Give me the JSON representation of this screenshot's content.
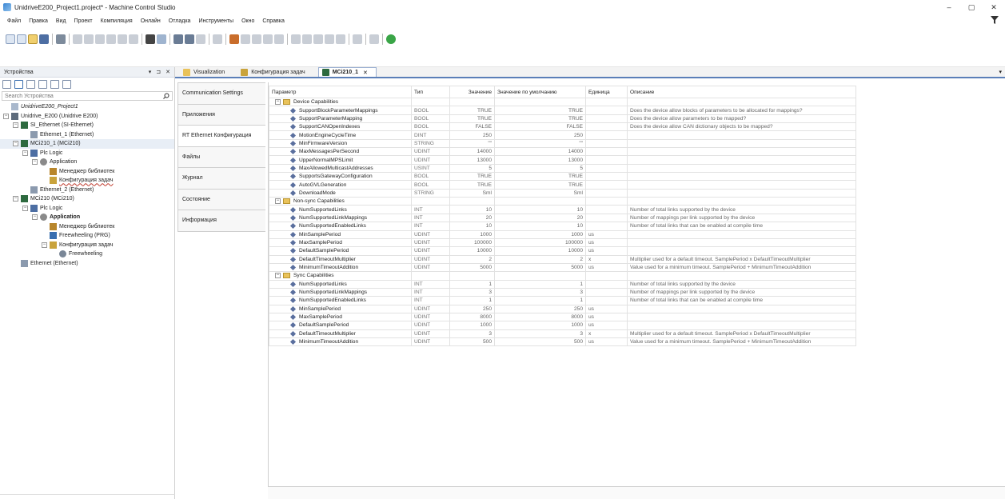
{
  "window": {
    "title": "UnidriveE200_Project1.project* - Machine Control Studio",
    "buttons": [
      "–",
      "▢",
      "✕"
    ]
  },
  "menu": [
    "Файл",
    "Правка",
    "Вид",
    "Проект",
    "Компиляция",
    "Онлайн",
    "Отладка",
    "Инструменты",
    "Окно",
    "Справка"
  ],
  "devices_pane": {
    "title": "Устройства",
    "controls": [
      "▾",
      "⊐",
      "✕"
    ],
    "search_placeholder": "Search Устройства",
    "tree": [
      {
        "label": "UnidriveE200_Project1",
        "level": 0,
        "exp": "",
        "icon": "project",
        "style": "italic"
      },
      {
        "label": "Unidrive_E200 (Unidrive E200)",
        "level": 0,
        "exp": "−",
        "icon": "drive",
        "style": ""
      },
      {
        "label": "SI_Ethernet (SI-Ethernet)",
        "level": 1,
        "exp": "−",
        "icon": "module",
        "style": ""
      },
      {
        "label": "Ethernet_1 (Ethernet)",
        "level": 2,
        "exp": "",
        "icon": "eth",
        "style": ""
      },
      {
        "label": "MCi210_1 (MCi210)",
        "level": 1,
        "exp": "−",
        "icon": "module",
        "style": "",
        "selected": true
      },
      {
        "label": "Plc Logic",
        "level": 2,
        "exp": "−",
        "icon": "plc",
        "style": ""
      },
      {
        "label": "Application",
        "level": 3,
        "exp": "−",
        "icon": "app",
        "style": ""
      },
      {
        "label": "Менеджер библиотек",
        "level": 4,
        "exp": "",
        "icon": "lib",
        "style": ""
      },
      {
        "label": "Конфигурация задач",
        "level": 4,
        "exp": "",
        "icon": "task",
        "style": "underline"
      },
      {
        "label": "Ethernet_2 (Ethernet)",
        "level": 2,
        "exp": "",
        "icon": "eth",
        "style": ""
      },
      {
        "label": "MCi210 (MCi210)",
        "level": 1,
        "exp": "−",
        "icon": "module",
        "style": ""
      },
      {
        "label": "Plc Logic",
        "level": 2,
        "exp": "−",
        "icon": "plc",
        "style": ""
      },
      {
        "label": "Application",
        "level": 3,
        "exp": "−",
        "icon": "app",
        "style": "bold"
      },
      {
        "label": "Менеджер библиотек",
        "level": 4,
        "exp": "",
        "icon": "lib",
        "style": ""
      },
      {
        "label": "Freewheeling (PRG)",
        "level": 4,
        "exp": "",
        "icon": "prg",
        "style": ""
      },
      {
        "label": "Конфигурация задач",
        "level": 4,
        "exp": "−",
        "icon": "task",
        "style": ""
      },
      {
        "label": "Freewheeling",
        "level": 5,
        "exp": "",
        "icon": "gear",
        "style": ""
      },
      {
        "label": "Ethernet (Ethernet)",
        "level": 1,
        "exp": "",
        "icon": "eth",
        "style": ""
      }
    ]
  },
  "editor_tabs": [
    {
      "label": "Visualization",
      "icon": "visu",
      "active": false
    },
    {
      "label": "Конфигурация задач",
      "icon": "task",
      "active": false
    },
    {
      "label": "MCi210_1",
      "icon": "module",
      "active": true,
      "close": "✕"
    }
  ],
  "side_tabs": [
    "Communication Settings",
    "Приложения",
    "RT Ethernet Конфигурация",
    "Файлы",
    "Журнал",
    "Состояние",
    "Информация"
  ],
  "side_tab_active": 2,
  "grid": {
    "headers": [
      "Параметр",
      "Тип",
      "Значение",
      "Значение по умолчанию",
      "Единица",
      "Описание"
    ],
    "groups": [
      {
        "name": "Device Capabilities",
        "rows": [
          {
            "name": "SupportBlockParameterMappings",
            "type": "BOOL",
            "value": "TRUE",
            "default": "TRUE",
            "unit": "",
            "desc": "Does the device allow blocks of parameters to be allocated for mappings?"
          },
          {
            "name": "SupportParameterMapping",
            "type": "BOOL",
            "value": "TRUE",
            "default": "TRUE",
            "unit": "",
            "desc": "Does the device allow parameters to be mapped?"
          },
          {
            "name": "SupportCANOpenIndexes",
            "type": "BOOL",
            "value": "FALSE",
            "default": "FALSE",
            "unit": "",
            "desc": "Does the device allow CAN dictionary objects to be mapped?"
          },
          {
            "name": "MotionEngineCycleTime",
            "type": "DINT",
            "value": "250",
            "default": "250",
            "unit": "",
            "desc": ""
          },
          {
            "name": "MinFirmwareVersion",
            "type": "STRING",
            "value": "\"\"",
            "default": "\"\"",
            "unit": "",
            "desc": ""
          },
          {
            "name": "MaxMessagesPerSecond",
            "type": "UDINT",
            "value": "14000",
            "default": "14000",
            "unit": "",
            "desc": ""
          },
          {
            "name": "UpperNormalMPSLimit",
            "type": "UDINT",
            "value": "13000",
            "default": "13000",
            "unit": "",
            "desc": ""
          },
          {
            "name": "MaxAllowedMulticastAddresses",
            "type": "USINT",
            "value": "5",
            "default": "5",
            "unit": "",
            "desc": ""
          },
          {
            "name": "SupportsGatewayConfiguration",
            "type": "BOOL",
            "value": "TRUE",
            "default": "TRUE",
            "unit": "",
            "desc": ""
          },
          {
            "name": "AutoGVLGeneration",
            "type": "BOOL",
            "value": "TRUE",
            "default": "TRUE",
            "unit": "",
            "desc": ""
          },
          {
            "name": "DownloadMode",
            "type": "STRING",
            "value": "Sml",
            "default": "Sml",
            "unit": "",
            "desc": ""
          }
        ]
      },
      {
        "name": "Non-sync Capabilities",
        "rows": [
          {
            "name": "NumSupportedLinks",
            "type": "INT",
            "value": "10",
            "default": "10",
            "unit": "",
            "desc": "Number of total links supported by the device"
          },
          {
            "name": "NumSupportedLinkMappings",
            "type": "INT",
            "value": "20",
            "default": "20",
            "unit": "",
            "desc": "Number of mappings per link supported by the device"
          },
          {
            "name": "NumSupportedEnabledLinks",
            "type": "INT",
            "value": "10",
            "default": "10",
            "unit": "",
            "desc": "Number of total links that can be enabled at compile time"
          },
          {
            "name": "MinSamplePeriod",
            "type": "UDINT",
            "value": "1000",
            "default": "1000",
            "unit": "us",
            "desc": ""
          },
          {
            "name": "MaxSamplePeriod",
            "type": "UDINT",
            "value": "100000",
            "default": "100000",
            "unit": "us",
            "desc": ""
          },
          {
            "name": "DefaultSamplePeriod",
            "type": "UDINT",
            "value": "10000",
            "default": "10000",
            "unit": "us",
            "desc": ""
          },
          {
            "name": "DefaultTimeoutMultiplier",
            "type": "UDINT",
            "value": "2",
            "default": "2",
            "unit": "x",
            "desc": "Multiplier used for a default timeout. SamplePeriod x DefaultTimeoutMultiplier"
          },
          {
            "name": "MinimumTimeoutAddition",
            "type": "UDINT",
            "value": "5000",
            "default": "5000",
            "unit": "us",
            "desc": "Value used for a minimum timeout. SamplePeriod + MinimumTimeoutAddition"
          }
        ]
      },
      {
        "name": "Sync Capabilities",
        "rows": [
          {
            "name": "NumSupportedLinks",
            "type": "INT",
            "value": "1",
            "default": "1",
            "unit": "",
            "desc": "Number of total links supported by the device"
          },
          {
            "name": "NumSupportedLinkMappings",
            "type": "INT",
            "value": "3",
            "default": "3",
            "unit": "",
            "desc": "Number of mappings per link supported by the device"
          },
          {
            "name": "NumSupportedEnabledLinks",
            "type": "INT",
            "value": "1",
            "default": "1",
            "unit": "",
            "desc": "Number of total links that can be enabled at compile time"
          },
          {
            "name": "MinSamplePeriod",
            "type": "UDINT",
            "value": "250",
            "default": "250",
            "unit": "us",
            "desc": ""
          },
          {
            "name": "MaxSamplePeriod",
            "type": "UDINT",
            "value": "8000",
            "default": "8000",
            "unit": "us",
            "desc": ""
          },
          {
            "name": "DefaultSamplePeriod",
            "type": "UDINT",
            "value": "1000",
            "default": "1000",
            "unit": "us",
            "desc": ""
          },
          {
            "name": "DefaultTimeoutMultiplier",
            "type": "UDINT",
            "value": "3",
            "default": "3",
            "unit": "x",
            "desc": "Multiplier used for a default timeout. SamplePeriod x DefaultTimeoutMultiplier"
          },
          {
            "name": "MinimumTimeoutAddition",
            "type": "UDINT",
            "value": "500",
            "default": "500",
            "unit": "us",
            "desc": "Value used for a minimum timeout. SamplePeriod + MinimumTimeoutAddition"
          }
        ]
      }
    ]
  },
  "colors": {
    "accent": "#5b7fb8",
    "folder": "#e9c25a",
    "param_icon": "#5a6f9e"
  }
}
